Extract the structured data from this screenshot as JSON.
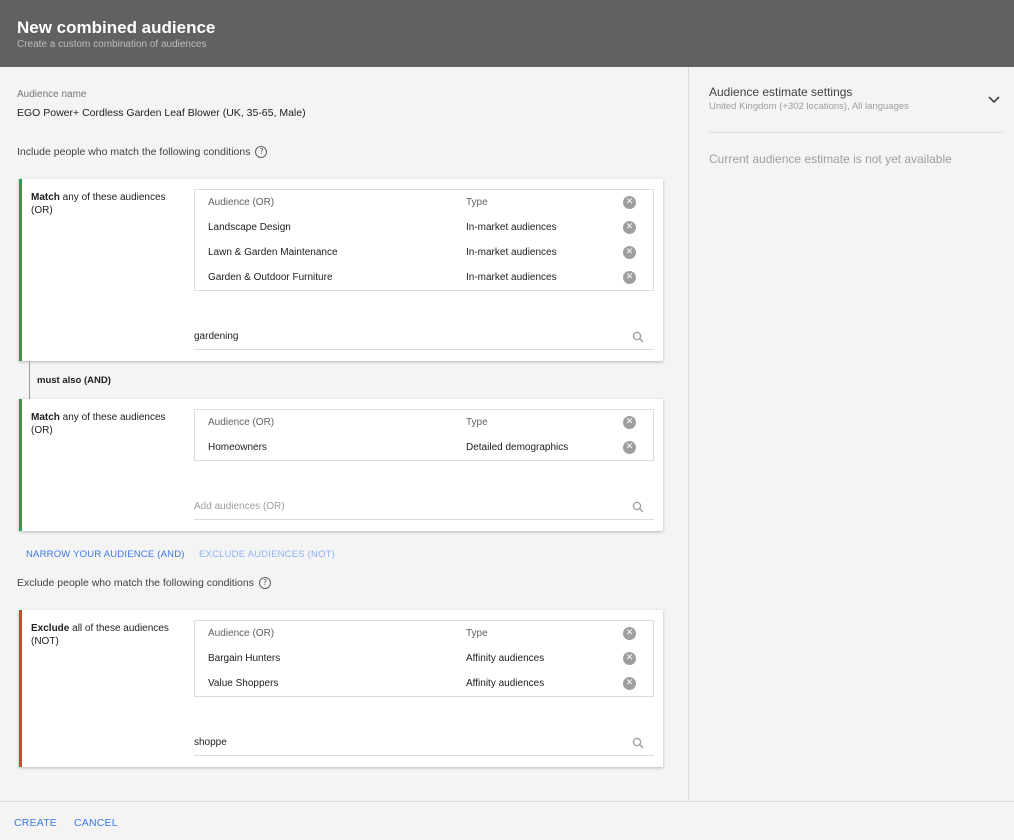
{
  "header": {
    "title": "New combined audience",
    "subtitle": "Create a custom combination of audiences"
  },
  "audience_name": {
    "label": "Audience name",
    "value": "EGO Power+ Cordless Garden Leaf Blower (UK, 35-65, Male)"
  },
  "include_label": "Include people who match the following conditions",
  "exclude_label": "Exclude people who match the following conditions",
  "help_icon_glyph": "?",
  "remove_icon_glyph": "✕",
  "groups": [
    {
      "head_bold": "Match",
      "head_rest": " any of these audiences (OR)",
      "col_audience": "Audience (OR)",
      "col_type": "Type",
      "rows": [
        {
          "audience": "Landscape Design",
          "type": "In-market audiences"
        },
        {
          "audience": "Lawn & Garden Maintenance",
          "type": "In-market audiences"
        },
        {
          "audience": "Garden & Outdoor Furniture",
          "type": "In-market audiences"
        }
      ],
      "search_value": "gardening"
    },
    {
      "head_bold": "Match",
      "head_rest": " any of these audiences (OR)",
      "col_audience": "Audience (OR)",
      "col_type": "Type",
      "rows": [
        {
          "audience": "Homeowners",
          "type": "Detailed demographics"
        }
      ],
      "search_placeholder": "Add audiences (OR)"
    }
  ],
  "and_label": "must also (AND)",
  "actions": {
    "narrow": "NARROW YOUR AUDIENCE (AND)",
    "exclude": "EXCLUDE AUDIENCES (NOT)"
  },
  "exclude_group": {
    "head_bold": "Exclude",
    "head_rest": " all of these audiences (NOT)",
    "col_audience": "Audience (OR)",
    "col_type": "Type",
    "rows": [
      {
        "audience": "Bargain Hunters",
        "type": "Affinity audiences"
      },
      {
        "audience": "Value Shoppers",
        "type": "Affinity audiences"
      }
    ],
    "search_value": "shoppe"
  },
  "footer": {
    "create": "CREATE",
    "cancel": "CANCEL"
  },
  "estimate": {
    "title": "Audience estimate settings",
    "subtitle": "United Kingdom (+302 locations), All languages",
    "note": "Current audience estimate is not yet available"
  },
  "colors": {
    "header_bg": "#616161",
    "accent_blue": "#3b78e7",
    "include_border": "#2e9c4e",
    "exclude_border": "#d3432f"
  }
}
